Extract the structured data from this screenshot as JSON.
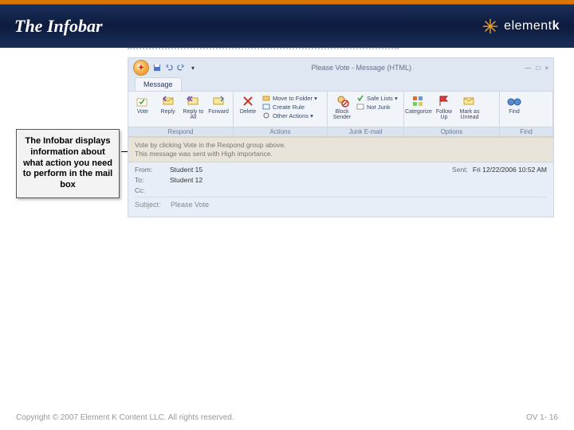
{
  "slide": {
    "title": "The Infobar",
    "brand": {
      "prefix": "element",
      "suffix": "k"
    },
    "callout": "The Infobar displays information about what action you need to perform in the mail box",
    "footer_left": "Copyright © 2007 Element K Content LLC. All rights reserved.",
    "footer_right": "OV 1- 16"
  },
  "outlook": {
    "window_title": "Please Vote - Message (HTML)",
    "tab": "Message",
    "ribbon": {
      "groups": [
        {
          "label": "Respond",
          "buttons": [
            "Vote",
            "Reply",
            "Reply to All",
            "Forward"
          ]
        },
        {
          "label": "Actions",
          "main": "Delete",
          "lines": [
            "Move to Folder ▾",
            "Create Rule",
            "Other Actions ▾"
          ]
        },
        {
          "label": "Junk E-mail",
          "main": "Block Sender",
          "lines": [
            "Safe Lists ▾",
            "Not Junk"
          ]
        },
        {
          "label": "Options",
          "buttons": [
            "Categorize",
            "Follow Up",
            "Mark as Unread"
          ]
        },
        {
          "label": "Find",
          "buttons": [
            "Find"
          ]
        }
      ]
    },
    "infobar": {
      "line1": "Vote by clicking Vote in the Respond group above.",
      "line2": "This message was sent with High importance."
    },
    "headers": {
      "from_label": "From:",
      "from": "Student 15",
      "to_label": "To:",
      "to": "Student 12",
      "cc_label": "Cc:",
      "cc": "",
      "subject_label": "Subject:",
      "subject": "Please Vote",
      "sent_label": "Sent:",
      "sent": "Fri 12/22/2006 10:52 AM"
    }
  }
}
